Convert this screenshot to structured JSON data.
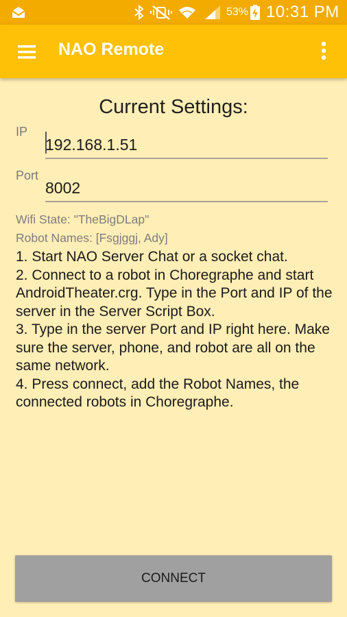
{
  "status_bar": {
    "battery_percent": "53%",
    "time": "10:31 PM",
    "icons": [
      "mail-notification-icon",
      "bluetooth-icon",
      "mute-vibrate-icon",
      "wifi-icon",
      "signal-icon",
      "battery-charging-icon"
    ]
  },
  "app_bar": {
    "title": "NAO Remote",
    "menu_icon": "hamburger-menu-icon",
    "overflow_icon": "more-vert-icon"
  },
  "settings": {
    "heading": "Current Settings:",
    "ip_label": "IP",
    "ip_value": "192.168.1.51",
    "port_label": "Port",
    "port_value": "8002",
    "wifi_state": "Wifi State: \"TheBigDLap\"",
    "robot_names": "Robot Names: [Fsgjggj, Ady]"
  },
  "instructions": [
    "1.   Start NAO Server Chat or a socket chat.",
    "2.   Connect to a robot in Choregraphe and start AndroidTheater.crg. Type in the Port and IP of the server in the Server Script Box.",
    "3.   Type in the server Port and IP right here. Make sure the server, phone, and robot are all on the same network.",
    "4.   Press connect, add the Robot Names, the connected robots in Choregraphe."
  ],
  "connect_button": {
    "label": "CONNECT"
  },
  "colors": {
    "status_bar": "#f3ab00",
    "app_bar": "#ffc107",
    "background": "#ffeeb6",
    "button": "#a0a0a0"
  }
}
